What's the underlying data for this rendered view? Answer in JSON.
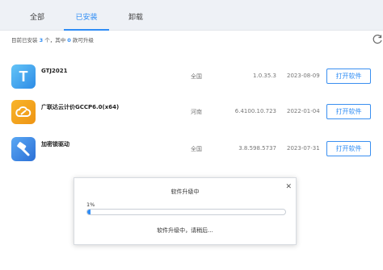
{
  "tabs": [
    {
      "label": "全部",
      "active": false
    },
    {
      "label": "已安装",
      "active": true
    },
    {
      "label": "卸载",
      "active": false
    }
  ],
  "summary": {
    "prefix": "目前已安装",
    "installed_count": "3",
    "middle": "个，其中",
    "upgradable_count": "0",
    "suffix": "款可升级"
  },
  "software": [
    {
      "name": "GTJ2021",
      "region": "全国",
      "version": "1.0.35.3",
      "date": "2023-08-09",
      "button": "打开软件",
      "icon": "gtj-app-icon",
      "color": "#3aa3ee"
    },
    {
      "name": "广联达云计价GCCP6.0(x64)",
      "region": "河南",
      "version": "6.4100.10.723",
      "date": "2022-01-04",
      "button": "打开软件",
      "icon": "gccp-app-icon",
      "color": "#f3a31c"
    },
    {
      "name": "加密锁驱动",
      "region": "全国",
      "version": "3.8.598.5737",
      "date": "2023-07-31",
      "button": "打开软件",
      "icon": "lock-driver-app-icon",
      "color": "#3a84e6"
    }
  ],
  "dialog": {
    "title": "软件升级中",
    "progress_label": "1%",
    "progress": 0.01,
    "message": "软件升级中，请稍后..."
  }
}
